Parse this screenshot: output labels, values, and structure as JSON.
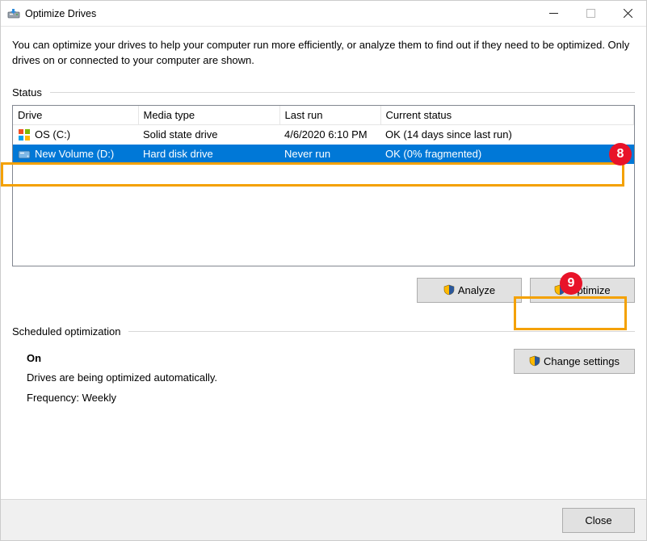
{
  "window": {
    "title": "Optimize Drives"
  },
  "intro": "You can optimize your drives to help your computer run more efficiently, or analyze them to find out if they need to be optimized. Only drives on or connected to your computer are shown.",
  "status_label": "Status",
  "columns": {
    "drive": "Drive",
    "media": "Media type",
    "lastrun": "Last run",
    "status": "Current status"
  },
  "drives": [
    {
      "name": "OS (C:)",
      "media": "Solid state drive",
      "lastrun": "4/6/2020 6:10 PM",
      "status": "OK (14 days since last run)",
      "icon": "ssd"
    },
    {
      "name": "New Volume (D:)",
      "media": "Hard disk drive",
      "lastrun": "Never run",
      "status": "OK (0% fragmented)",
      "icon": "hdd"
    }
  ],
  "buttons": {
    "analyze": "Analyze",
    "optimize": "Optimize",
    "change_settings": "Change settings",
    "close": "Close"
  },
  "schedule": {
    "label": "Scheduled optimization",
    "state": "On",
    "desc": "Drives are being optimized automatically.",
    "freq": "Frequency: Weekly"
  },
  "callouts": {
    "row": "8",
    "optimize": "9"
  }
}
